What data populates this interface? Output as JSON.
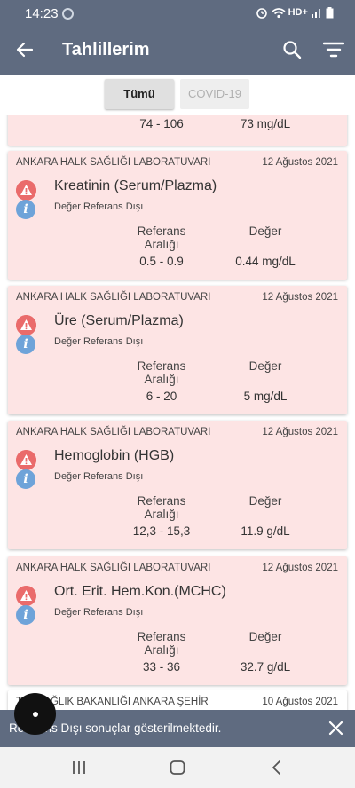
{
  "status_bar": {
    "time": "14:23",
    "network": "HD+"
  },
  "app_bar": {
    "title": "Tahlillerim"
  },
  "tabs": [
    {
      "label": "Tümü"
    },
    {
      "label": "COVID-19"
    }
  ],
  "partial_card": {
    "range": "74 - 106",
    "value": "73 mg/dL"
  },
  "headers": {
    "range": "Referans Aralığı",
    "value": "Değer"
  },
  "cards": [
    {
      "lab": "ANKARA HALK SAĞLIĞI LABORATUVARI",
      "date": "12 Ağustos 2021",
      "test": "Kreatinin (Serum/Plazma)",
      "status": "Değer Referans Dışı",
      "range": "0.5 - 0.9",
      "value": "0.44 mg/dL"
    },
    {
      "lab": "ANKARA HALK SAĞLIĞI LABORATUVARI",
      "date": "12 Ağustos 2021",
      "test": "Üre (Serum/Plazma)",
      "status": "Değer Referans Dışı",
      "range": "6 - 20",
      "value": "5 mg/dL"
    },
    {
      "lab": "ANKARA HALK SAĞLIĞI LABORATUVARI",
      "date": "12 Ağustos 2021",
      "test": "Hemoglobin (HGB)",
      "status": "Değer Referans Dışı",
      "range": "12,3 - 15,3",
      "value": "11.9 g/dL"
    },
    {
      "lab": "ANKARA HALK SAĞLIĞI LABORATUVARI",
      "date": "12 Ağustos 2021",
      "test": "Ort. Erit. Hem.Kon.(MCHC)",
      "status": "Değer Referans Dışı",
      "range": "33 - 36",
      "value": "32.7 g/dL"
    }
  ],
  "partial_bottom_card": {
    "lab": "T.C. SAĞLIK BAKANLIĞI ANKARA ŞEHİR",
    "date": "10 Ağustos 2021"
  },
  "snackbar": {
    "message": "Referans Dışı sonuçlar gösterilmektedir."
  },
  "colors": {
    "app_bar": "#5f6b80",
    "card_out_of_range": "#fde4e4",
    "warning": "#ea6b6b",
    "info": "#6ea3d9"
  },
  "icons": {
    "back": "back-arrow-icon",
    "search": "search-icon",
    "filter": "filter-icon",
    "warning": "warning-icon",
    "info": "info-icon",
    "close": "close-icon"
  }
}
